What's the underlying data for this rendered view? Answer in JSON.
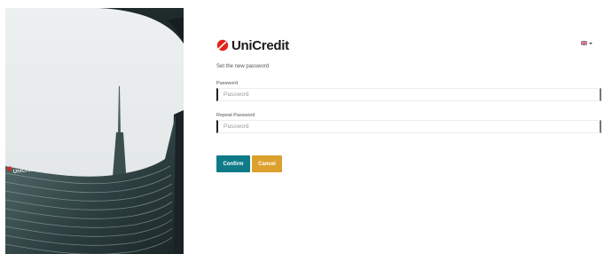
{
  "brand": {
    "name": "UniCredit",
    "building_sign": "UniCredit"
  },
  "colors": {
    "brand_red": "#e2231a",
    "confirm": "#0f7b89",
    "cancel": "#dca02d"
  },
  "language": {
    "flag_icon": "uk-flag-icon"
  },
  "form": {
    "subtitle": "Set the new password",
    "password_label": "Password",
    "password_placeholder": "Password",
    "repeat_label": "Repeat Password",
    "repeat_placeholder": "Password"
  },
  "buttons": {
    "confirm": "Confirm",
    "cancel": "Cancel"
  }
}
